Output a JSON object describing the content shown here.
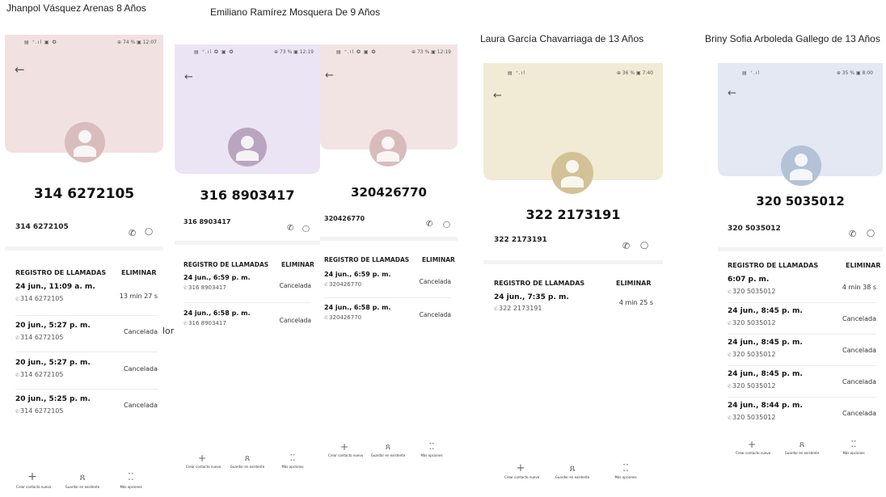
{
  "captions": {
    "c1": "Jhanpol Vásquez Arenas 8 Años",
    "c2": "Emiliano Ramírez Mosquera De 9 Años",
    "c3": "Laura García Chavarriaga de 13 Años",
    "c4": "Briny Sofia Arboleda Gallego de 13 Años"
  },
  "stray_text": "lor",
  "icons": {
    "back": "←",
    "call": "✆",
    "message": "◯",
    "phone_small": "✆",
    "add": "+",
    "person": "ጸ",
    "more": "⁚⁚"
  },
  "labels": {
    "registro": "REGISTRO DE LLAMADAS",
    "eliminar": "ELIMINAR",
    "crear": "Crear contacto nuevo",
    "guardar": "Guardar en existente",
    "mas": "Más opciones"
  },
  "colors": {
    "p1_header": "#f2e1e1",
    "p2_header": "#ebe4f5",
    "p3_header": "#f3e4e4",
    "p4_header": "#f1ead4",
    "p5_header": "#e3e8f3"
  },
  "phones": [
    {
      "status_left": "▤ ⁺.ıl ▣ ✪",
      "status_right": "⊕ 74 % ▣ 12:07",
      "number_big": "314 6272105",
      "number_small": "314 6272105",
      "calls": [
        {
          "date": "24 jun., 11:09 a. m.",
          "number": "314 6272105",
          "result": "13 min 27 s"
        },
        {
          "date": "20 jun., 5:27 p. m.",
          "number": "314 6272105",
          "result": "Cancelada"
        },
        {
          "date": "20 jun., 5:27 p. m.",
          "number": "314 6272105",
          "result": "Cancelada"
        },
        {
          "date": "20 jun., 5:25 p. m.",
          "number": "314 6272105",
          "result": "Cancelada"
        }
      ]
    },
    {
      "status_left": "▤ ⁺.ıl ✪ ▣ ✪",
      "status_right": "⊕ 73 % ▣ 12:19",
      "number_big": "316 8903417",
      "number_small": "316 8903417",
      "calls": [
        {
          "date": "24 jun., 6:59 p. m.",
          "number": "316 8903417",
          "result": "Cancelada"
        },
        {
          "date": "24 jun., 6:58 p. m.",
          "number": "316 8903417",
          "result": "Cancelada"
        }
      ]
    },
    {
      "status_left": "▤ ⁺.ıl ✪ ▣ ✪",
      "status_right": "⊕ 73 % ▣ 12:19",
      "number_big": "320426770",
      "number_small": "320426770",
      "calls": [
        {
          "date": "24 jun., 6:59 p. m.",
          "number": "320426770",
          "result": "Cancelada"
        },
        {
          "date": "24 jun., 6:58 p. m.",
          "number": "320426770",
          "result": "Cancelada"
        }
      ]
    },
    {
      "status_left": "▤ ⁺.ıl",
      "status_right": "⊕ 36 % ▣ 7:40",
      "number_big": "322 2173191",
      "number_small": "322 2173191",
      "calls": [
        {
          "date": "24 jun., 7:35 p. m.",
          "number": "322 2173191",
          "result": "4 min 25 s"
        }
      ]
    },
    {
      "status_left": "▤ ⁺.ıl",
      "status_right": "⊕ 35 % ▣ 8:00",
      "number_big": "320 5035012",
      "number_small": "320 5035012",
      "calls": [
        {
          "date": "6:07 p. m.",
          "number": "320 5035012",
          "result": "4 min 38 s"
        },
        {
          "date": "24 jun., 8:45 p. m.",
          "number": "320 5035012",
          "result": "Cancelada"
        },
        {
          "date": "24 jun., 8:45 p. m.",
          "number": "320 5035012",
          "result": "Cancelada"
        },
        {
          "date": "24 jun., 8:45 p. m.",
          "number": "320 5035012",
          "result": "Cancelada"
        },
        {
          "date": "24 jun., 8:44 p. m.",
          "number": "320 5035012",
          "result": "Cancelada"
        }
      ]
    }
  ]
}
